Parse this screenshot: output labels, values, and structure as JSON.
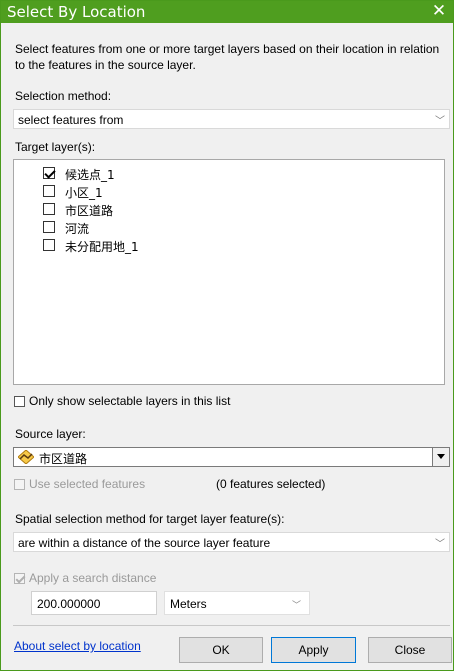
{
  "window": {
    "title": "Select By Location",
    "close_glyph": "✕"
  },
  "description": "Select features from one or more target layers based on their location in relation to the features in the source layer.",
  "selection_method": {
    "label": "Selection method:",
    "value": "select features from"
  },
  "target_layers": {
    "label": "Target layer(s):",
    "items": [
      {
        "label": "候选点_1",
        "checked": true
      },
      {
        "label": "小区_1",
        "checked": false
      },
      {
        "label": "市区道路",
        "checked": false
      },
      {
        "label": "河流",
        "checked": false
      },
      {
        "label": "未分配用地_1",
        "checked": false
      }
    ]
  },
  "only_selectable": {
    "label": "Only show selectable layers in this list",
    "checked": false
  },
  "source_layer": {
    "label": "Source layer:",
    "value": "市区道路",
    "icon": "line-layer-icon"
  },
  "use_selected": {
    "label": "Use selected features",
    "checked": false,
    "count_text": "(0 features selected)"
  },
  "spatial_method": {
    "label": "Spatial selection method for target layer feature(s):",
    "value": "are within a distance of the source layer feature"
  },
  "search_distance": {
    "label": "Apply a search distance",
    "checked": true,
    "value": "200.000000",
    "unit": "Meters"
  },
  "footer": {
    "about_link": "About select by location",
    "ok_label": "OK",
    "apply_label": "Apply",
    "close_label": "Close"
  },
  "colors": {
    "title_bar": "#4f9e1f",
    "link": "#0033cc",
    "default_button_border": "#0078d7"
  }
}
